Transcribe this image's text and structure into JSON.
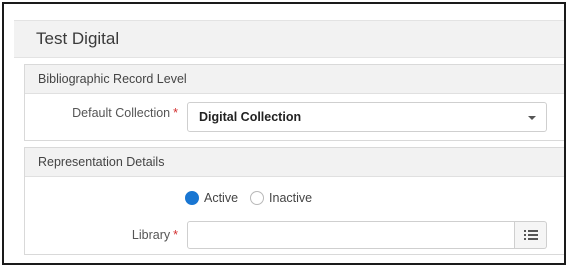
{
  "page": {
    "title": "Test Digital"
  },
  "bibliographic_section": {
    "header": "Bibliographic Record Level",
    "default_collection": {
      "label": "Default Collection",
      "required_mark": "*",
      "selected_value": "Digital Collection"
    }
  },
  "representation_section": {
    "header": "Representation Details",
    "status_options": [
      {
        "label": "Active",
        "selected": true
      },
      {
        "label": "Inactive",
        "selected": false
      }
    ],
    "library": {
      "label": "Library",
      "required_mark": "*",
      "value": ""
    }
  },
  "icons": {
    "dropdown": "chevron-down-icon",
    "library_picker": "list-icon"
  },
  "colors": {
    "required": "#d32f2f",
    "radio_selected": "#1976d2"
  }
}
